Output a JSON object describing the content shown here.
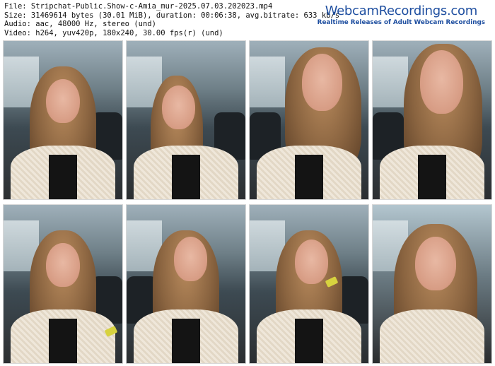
{
  "meta": {
    "line1": "File: Stripchat-Public.Show-c-Amia_mur-2025.07.03.202023.mp4",
    "line2": "Size: 31469614 bytes (30.01 MiB), duration: 00:06:38, avg.bitrate: 633 kb/s",
    "line3": "Audio: aac, 48000 Hz, stereo (und)",
    "line4": "Video: h264, yuv420p, 180x240, 30.00 fps(r) (und)"
  },
  "logo": {
    "title": "WebcamRecordings.com",
    "tagline": "Realtime Releases of Adult Webcam Recordings"
  },
  "thumbnails": [
    {
      "index": 1
    },
    {
      "index": 2
    },
    {
      "index": 3
    },
    {
      "index": 4
    },
    {
      "index": 5
    },
    {
      "index": 6
    },
    {
      "index": 7
    },
    {
      "index": 8
    }
  ]
}
